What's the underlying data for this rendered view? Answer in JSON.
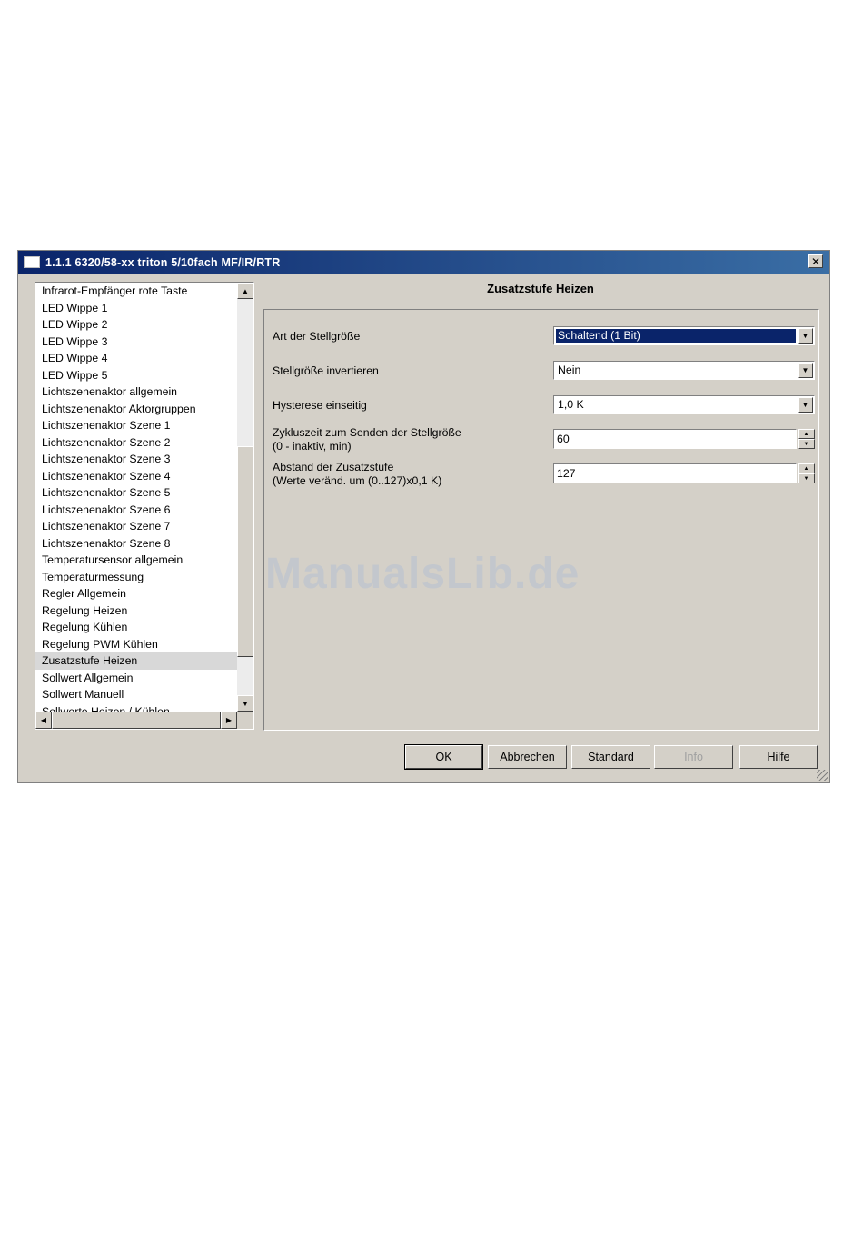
{
  "window": {
    "title": "1.1.1 6320/58-xx triton 5/10fach MF/IR/RTR",
    "close_label": "✕"
  },
  "tree": {
    "items": [
      "Infrarot-Empfänger rote Taste",
      "LED Wippe 1",
      "LED Wippe 2",
      "LED Wippe 3",
      "LED Wippe 4",
      "LED Wippe 5",
      "Lichtszenenaktor allgemein",
      "Lichtszenenaktor Aktorgruppen",
      "Lichtszenenaktor Szene 1",
      "Lichtszenenaktor Szene 2",
      "Lichtszenenaktor Szene 3",
      "Lichtszenenaktor Szene 4",
      "Lichtszenenaktor Szene 5",
      "Lichtszenenaktor Szene 6",
      "Lichtszenenaktor Szene 7",
      "Lichtszenenaktor Szene 8",
      "Temperatursensor allgemein",
      "Temperaturmessung",
      "Regler Allgemein",
      "Regelung Heizen",
      "Regelung Kühlen",
      "Regelung PWM Kühlen",
      "Zusatzstufe Heizen",
      "Sollwert Allgemein",
      "Sollwert Manuell",
      "Sollwerte Heizen / Kühlen"
    ],
    "selected": "Zusatzstufe Heizen"
  },
  "panel": {
    "title": "Zusatzstufe Heizen",
    "params": {
      "stellgroesse_art": {
        "label": "Art der Stellgröße",
        "value": "Schaltend (1 Bit)"
      },
      "stellgroesse_invert": {
        "label": "Stellgröße invertieren",
        "value": "Nein"
      },
      "hysterese": {
        "label": "Hysterese einseitig",
        "value": "1,0 K"
      },
      "zykluszeit": {
        "label_line1": "Zykluszeit zum Senden der Stellgröße",
        "label_line2": "(0 - inaktiv, min)",
        "value": "60"
      },
      "abstand": {
        "label_line1": "Abstand der Zusatzstufe",
        "label_line2": "(Werte veränd. um (0..127)x0,1 K)",
        "value": "127"
      }
    }
  },
  "watermark": "ManualsLib.de",
  "buttons": {
    "ok": "OK",
    "cancel": "Abbrechen",
    "standard": "Standard",
    "info": "Info",
    "help": "Hilfe"
  },
  "icons": {
    "scroll_up": "▲",
    "scroll_down": "▼",
    "scroll_left": "◀",
    "scroll_right": "▶",
    "combo_arrow": "▼",
    "spin_up": "▲",
    "spin_down": "▼"
  }
}
